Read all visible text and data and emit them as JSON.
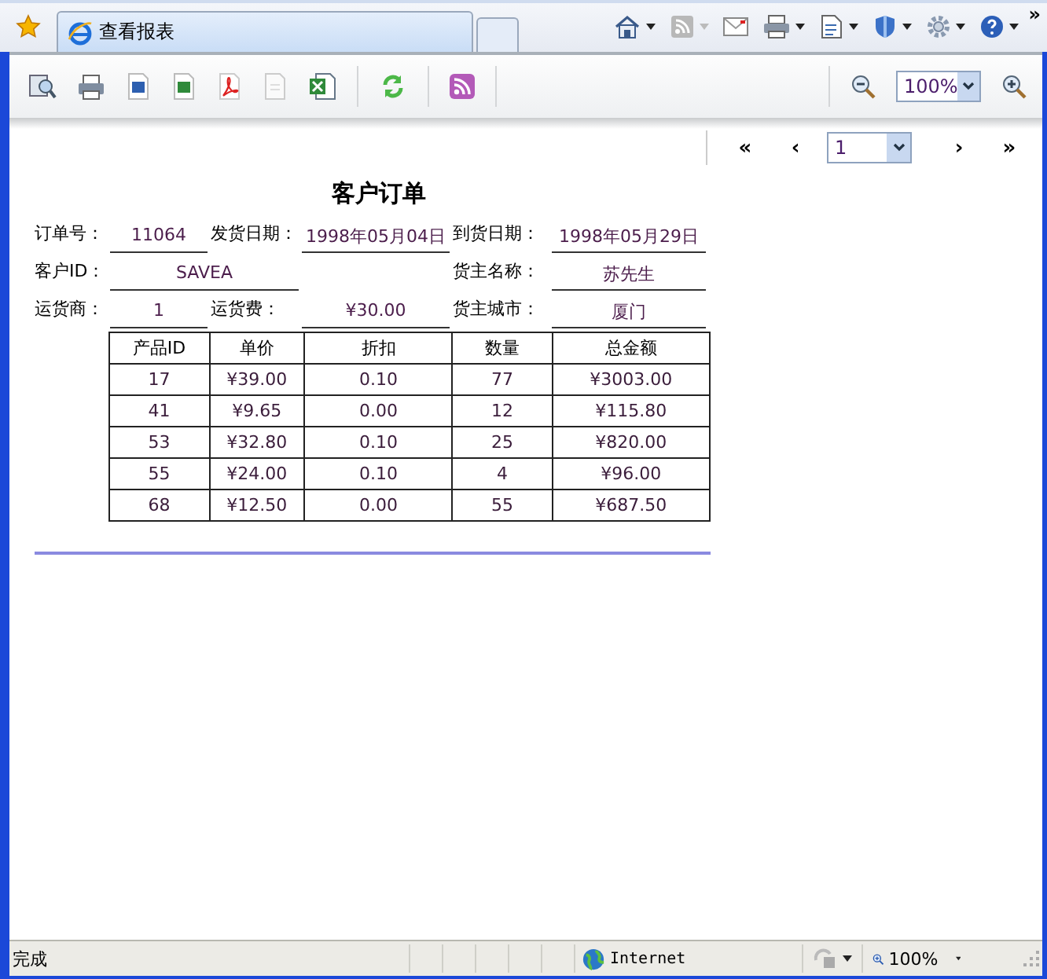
{
  "browser": {
    "tab_title": "查看报表",
    "overflow": "»"
  },
  "toolbar": {
    "zoom": "100%"
  },
  "pager": {
    "first": "«",
    "prev": "‹",
    "page": "1",
    "next": "›",
    "last": "»"
  },
  "report": {
    "title": "客户订单",
    "field_rows": [
      [
        {
          "label": "订单号：",
          "value": "11064",
          "wide": false
        },
        {
          "label": "发货日期：",
          "value": "1998年05月04日",
          "wide": false
        },
        {
          "label": "到货日期：",
          "value": "1998年05月29日",
          "wide": false
        }
      ],
      [
        {
          "label": "客户ID：",
          "value": "SAVEA",
          "wide": true
        },
        {
          "label": "货主名称：",
          "value": "苏先生",
          "wide": false
        }
      ],
      [
        {
          "label": "运货商：",
          "value": "1",
          "wide": false
        },
        {
          "label": "运货费：",
          "value": "¥30.00",
          "wide": false
        },
        {
          "label": "货主城市：",
          "value": "厦门",
          "wide": false
        }
      ]
    ],
    "table": {
      "columns": [
        "产品ID",
        "单价",
        "折扣",
        "数量",
        "总金额"
      ],
      "rows": [
        [
          "17",
          "¥39.00",
          "0.10",
          "77",
          "¥3003.00"
        ],
        [
          "41",
          "¥9.65",
          "0.00",
          "12",
          "¥115.80"
        ],
        [
          "53",
          "¥32.80",
          "0.10",
          "25",
          "¥820.00"
        ],
        [
          "55",
          "¥24.00",
          "0.10",
          "4",
          "¥96.00"
        ],
        [
          "68",
          "¥12.50",
          "0.00",
          "55",
          "¥687.50"
        ]
      ]
    }
  },
  "status_bar": {
    "text": "完成",
    "zone": "Internet",
    "zoom": "100%"
  }
}
